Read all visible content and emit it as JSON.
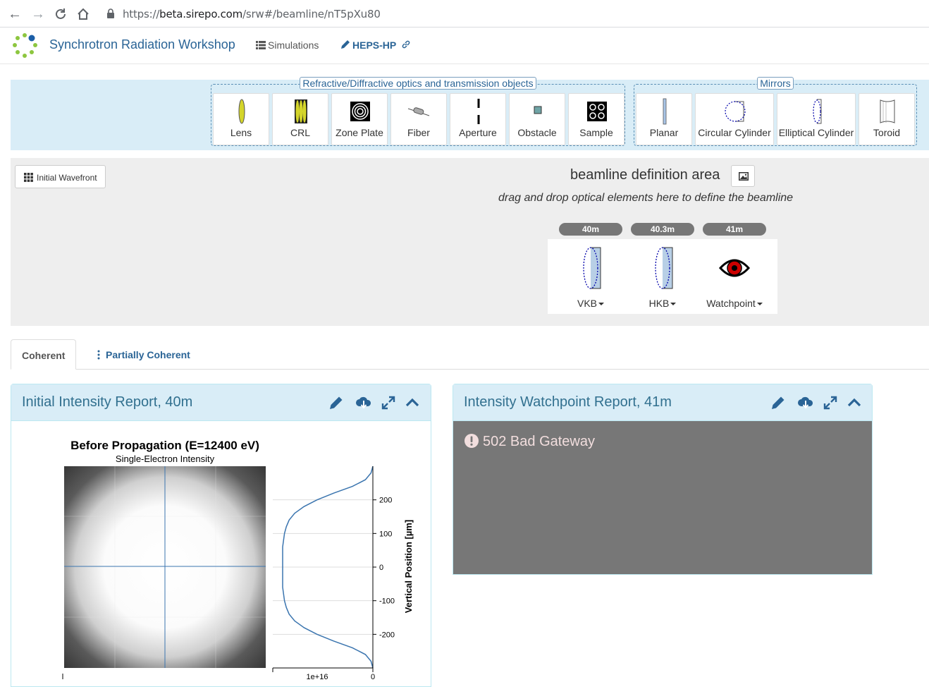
{
  "browser": {
    "url_scheme": "https://",
    "url_host": "beta.sirepo.com",
    "url_path": "/srw#/beamline/nT5pXu80"
  },
  "navbar": {
    "brand": "Synchrotron Radiation Workshop",
    "simulations": "Simulations",
    "sim_name": "HEPS-HP"
  },
  "toolbar": {
    "groups": [
      {
        "label": "Refractive/Diffractive optics and transmission objects",
        "items": [
          "Lens",
          "CRL",
          "Zone Plate",
          "Fiber",
          "Aperture",
          "Obstacle",
          "Sample"
        ]
      },
      {
        "label": "Mirrors",
        "items": [
          "Planar",
          "Circular Cylinder",
          "Elliptical Cylinder",
          "Toroid"
        ]
      }
    ]
  },
  "beamline": {
    "initial_wavefront": "Initial Wavefront",
    "title": "beamline definition area",
    "hint": "drag and drop optical elements here to define the beamline",
    "elements": [
      {
        "position": "40m",
        "name": "VKB"
      },
      {
        "position": "40.3m",
        "name": "HKB"
      },
      {
        "position": "41m",
        "name": "Watchpoint"
      }
    ]
  },
  "tabs": [
    {
      "label": "Coherent",
      "active": true
    },
    {
      "label": "Partially Coherent",
      "active": false
    }
  ],
  "reports": [
    {
      "title": "Initial Intensity Report, 40m"
    },
    {
      "title": "Intensity Watchpoint Report, 41m",
      "error": "502 Bad Gateway"
    }
  ],
  "chart_data": {
    "type": "heatmap",
    "title": "Before Propagation (E=12400 eV)",
    "subtitle": "Single-Electron Intensity",
    "ylabel": "Vertical Position [µm]",
    "y_ticks": [
      200,
      100,
      0,
      -100,
      -200
    ],
    "x_tick_labels": [
      "1e+16",
      "0"
    ],
    "ylim": [
      -300,
      300
    ],
    "profile": {
      "y": [
        -300,
        -280,
        -260,
        -240,
        -220,
        -200,
        -180,
        -160,
        -140,
        -120,
        -100,
        -80,
        -60,
        -40,
        -20,
        0,
        20,
        40,
        60,
        80,
        100,
        120,
        140,
        160,
        180,
        200,
        220,
        240,
        260,
        280,
        300
      ],
      "intensity": [
        0.0,
        0.02,
        0.08,
        0.22,
        0.42,
        0.6,
        0.74,
        0.84,
        0.9,
        0.93,
        0.95,
        0.96,
        0.97,
        0.97,
        0.97,
        0.97,
        0.97,
        0.97,
        0.97,
        0.96,
        0.95,
        0.93,
        0.9,
        0.84,
        0.74,
        0.6,
        0.42,
        0.22,
        0.08,
        0.02,
        0.0
      ]
    }
  },
  "colors": {
    "link": "#2a6496",
    "panel_head": "#d9edf7",
    "panel_title": "#31708f",
    "error_bg": "#777777",
    "error_text": "#f2dede",
    "curve": "#3b75af"
  }
}
